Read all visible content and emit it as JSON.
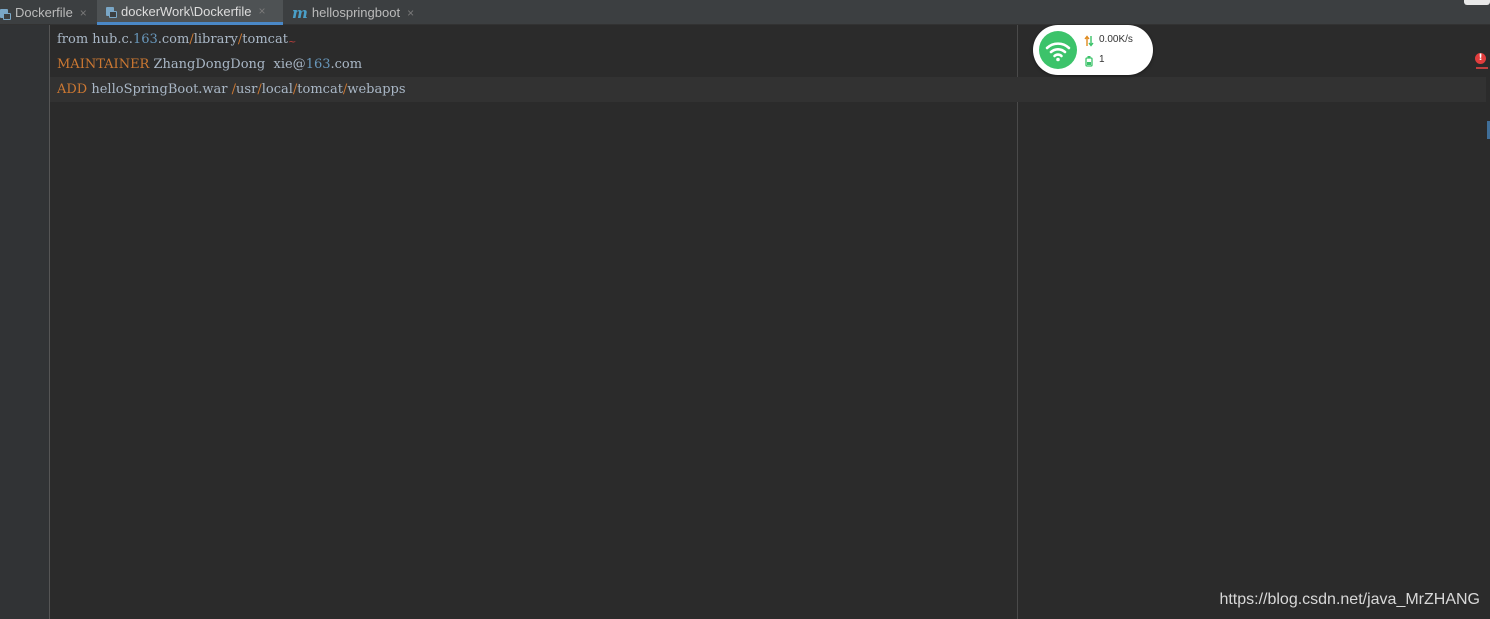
{
  "tabs": [
    {
      "label": "Dockerfile",
      "icon": "dockerfile-file-icon",
      "active": false
    },
    {
      "label": "dockerWork\\Dockerfile",
      "icon": "dockerfile-file-icon",
      "active": true
    },
    {
      "label": "hellospringboot",
      "icon": "maven-m-icon",
      "active": false
    }
  ],
  "tab_close_glyph": "×",
  "editor": {
    "lines": [
      {
        "p1": "from hub.c.",
        "p2": "163",
        "p3": ".com",
        "p4": "/",
        "p5": "library",
        "p6": "/",
        "p7": "tomcat",
        "p8": "~"
      },
      {
        "p1": "MAINTAINER",
        "p2": " ZhangDongDong  xie@",
        "p3": "163",
        "p4": ".com"
      },
      {
        "p1": "ADD",
        "p2": " helloSpringBoot.war ",
        "p3": "/",
        "p4": "usr",
        "p5": "/",
        "p6": "local",
        "p7": "/",
        "p8": "tomcat",
        "p9": "/",
        "p10": "webapps"
      }
    ],
    "current_line": 2,
    "error_badge": "!"
  },
  "network_widget": {
    "speed": "0.00K/s",
    "connections": "1",
    "accent_color": "#3cc36a"
  },
  "watermark": "https://blog.csdn.net/java_MrZHANG",
  "colors": {
    "keyword": "#cc7832",
    "number": "#6897bb",
    "text": "#a9b7c6",
    "background": "#2b2b2b",
    "active_tab_underline": "#4a88c7"
  }
}
